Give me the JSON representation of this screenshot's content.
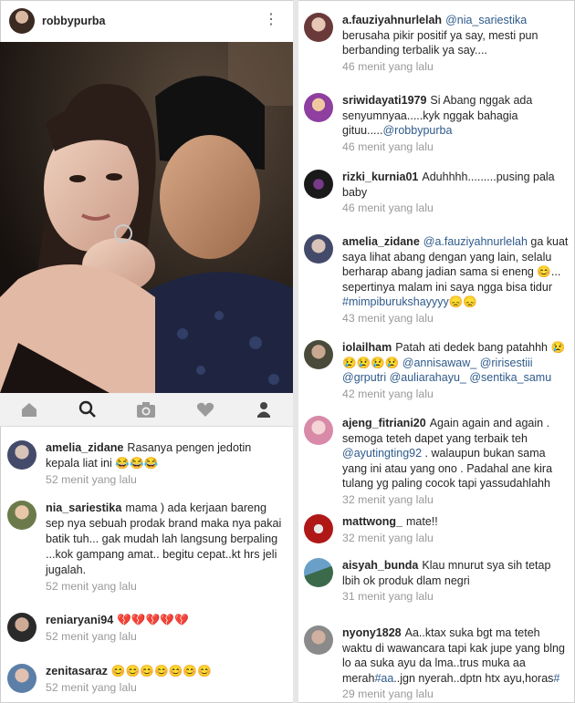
{
  "post": {
    "username": "robbypurba",
    "more_icon": "more-vertical-icon"
  },
  "nav": [
    "home-icon",
    "search-icon",
    "camera-icon",
    "heart-icon",
    "profile-icon"
  ],
  "left_comments": [
    {
      "user": "amelia_zidane",
      "text": "Rasanya pengen jedotin kepala liat ini 😂😂😂",
      "time": "52 menit yang lalu"
    },
    {
      "user": "nia_sariestika",
      "text": "mama ) ada kerjaan bareng sep nya sebuah prodak brand maka nya pakai batik tuh... gak mudah lah langsung berpaling ...kok gampang amat.. begitu cepat..kt hrs jeli jugalah.",
      "time": "52 menit yang lalu"
    },
    {
      "user": "reniaryani94",
      "text": "💔💔💔💔💔",
      "time": "52 menit yang lalu"
    },
    {
      "user": "zenitasaraz",
      "text": "😊😊😊😊😊😊😊",
      "time": "52 menit yang lalu"
    }
  ],
  "right_comments": [
    {
      "user": "a.fauziyahnurlelah",
      "mention": "@nia_sariestika",
      "text": "berusaha pikir positif ya say, mesti pun berbanding terbalik ya say....",
      "time": "46 menit yang lalu"
    },
    {
      "user": "sriwidayati1979",
      "text": "Si Abang nggak ada senyumnyaa.....kyk nggak bahagia gituu.....",
      "mention": "@robbypurba",
      "time": "46 menit yang lalu"
    },
    {
      "user": "rizki_kurnia01",
      "text": "Aduhhhh.........pusing pala baby",
      "time": "46 menit yang lalu"
    },
    {
      "user": "amelia_zidane",
      "mention": "@a.fauziyahnurlelah",
      "text": "ga kuat saya lihat abang dengan yang lain, selalu berharap abang jadian sama si eneng 😊... sepertinya malam ini saya ngga bisa tidur",
      "tag": "#mimpiburukshayyyy",
      "tail": "😞😞",
      "time": "43 menit yang lalu"
    },
    {
      "user": "iolailham",
      "text": "Patah ati dedek bang patahhh 😢😢😢😢😢",
      "mentions": "@annisawaw_ @ririsestiii @grputri @auliarahayu_ @sentika_samu",
      "time": "42 menit yang lalu"
    },
    {
      "user": "ajeng_fitriani20",
      "text": "Again again and again . semoga teteh dapet yang terbaik teh",
      "mention": "@ayutingting92",
      "text2": ". walaupun bukan sama yang ini atau yang ono . Padahal ane kira tulang yg paling cocok tapi yassudahlahh",
      "time": "32 menit yang lalu"
    },
    {
      "user": "mattwong_",
      "text": "mate!!",
      "time": "32 menit yang lalu"
    },
    {
      "user": "aisyah_bunda",
      "text": "Klau mnurut sya sih tetap lbih ok produk dlam negri",
      "time": "31 menit yang lalu"
    },
    {
      "user": "nyony1828",
      "text": "Aa..ktax suka bgt ma teteh waktu di wawancara tapi kak jupe yang blng lo aa suka ayu da lma..trus muka aa merah",
      "tag": "#aa",
      "text2": "..jgn nyerah..dptn htx ayu,horas",
      "tag2": "#",
      "time": "29 menit yang lalu"
    }
  ],
  "colors": {
    "username": "#262626",
    "mention": "#2e5a8a",
    "time": "#999999",
    "navbar": "#f1f1f1"
  }
}
